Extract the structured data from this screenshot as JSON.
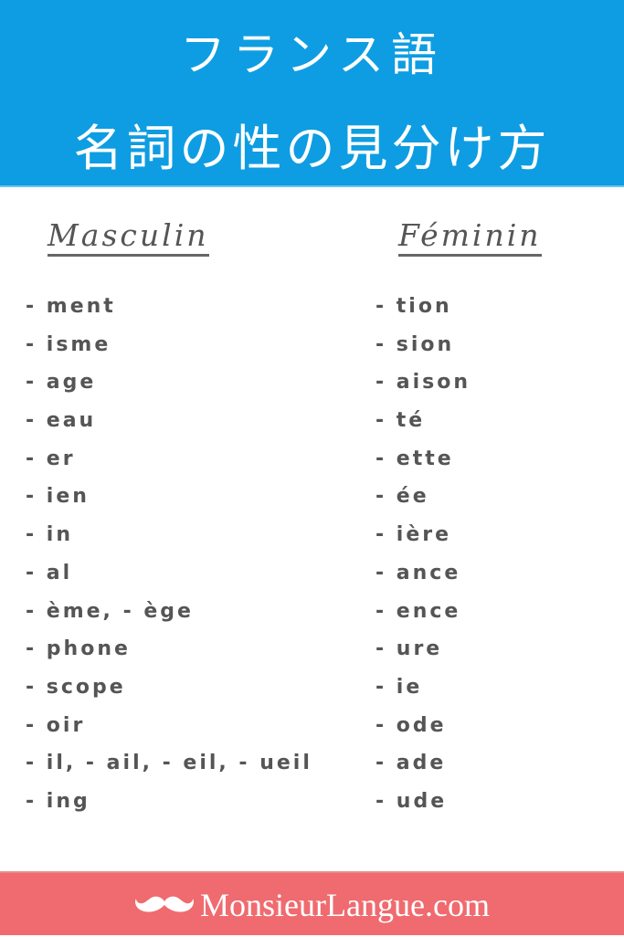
{
  "header": {
    "title_line1": "フランス語",
    "title_line2": "名詞の性の見分け方",
    "background": "#0e9de2"
  },
  "columns": {
    "masculine": {
      "heading": "Masculin",
      "items": [
        "- ment",
        "- isme",
        "- age",
        "- eau",
        "- er",
        "- ien",
        "- in",
        "- al",
        "- ème, - ège",
        "- phone",
        "- scope",
        "- oir",
        "- il, - ail, - eil, - ueil",
        "- ing"
      ]
    },
    "feminine": {
      "heading": "Féminin",
      "items": [
        "- tion",
        "- sion",
        "- aison",
        "- té",
        "- ette",
        "- ée",
        "- ière",
        "- ance",
        "- ence",
        "- ure",
        "- ie",
        "- ode",
        "- ade",
        "- ude"
      ]
    }
  },
  "footer": {
    "icon": "mustache-icon",
    "brand": "MonsieurLangue.com",
    "background": "#ef6b6f"
  }
}
